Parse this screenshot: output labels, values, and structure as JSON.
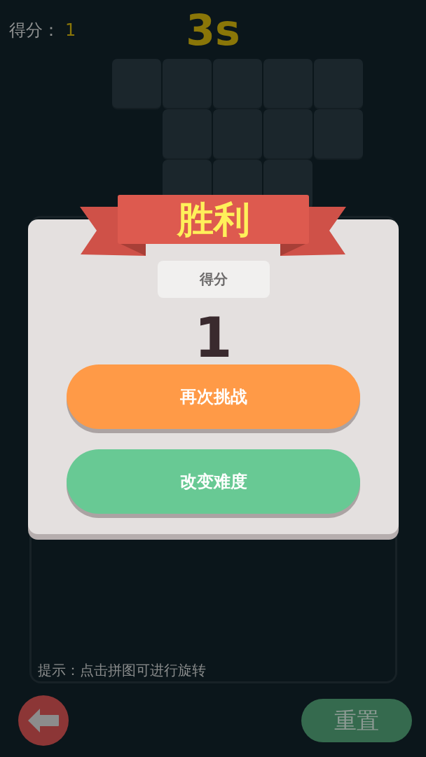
{
  "header": {
    "score_label": "得分：",
    "score": "1",
    "timer": "3s"
  },
  "puzzle": {
    "rows": [
      {
        "cells": [
          {
            "filled": true
          },
          {
            "filled": true
          },
          {
            "filled": true
          },
          {
            "filled": true
          },
          {
            "filled": true
          }
        ]
      },
      {
        "cells": [
          {
            "filled": false
          },
          {
            "filled": true
          },
          {
            "filled": true
          },
          {
            "filled": true
          },
          {
            "filled": true
          }
        ]
      },
      {
        "cells": [
          {
            "filled": false
          },
          {
            "filled": true
          },
          {
            "filled": true
          },
          {
            "filled": true
          },
          {
            "filled": false
          }
        ]
      }
    ]
  },
  "dialog": {
    "title": "胜利",
    "score_label": "得分",
    "score": "1",
    "buttons": [
      {
        "label": "再次挑战",
        "kind": "retry"
      },
      {
        "label": "改变难度",
        "kind": "difficulty"
      }
    ]
  },
  "board": {
    "hint": "提示：点击拼图可进行旋转"
  },
  "footer": {
    "reset_button": "重置"
  }
}
